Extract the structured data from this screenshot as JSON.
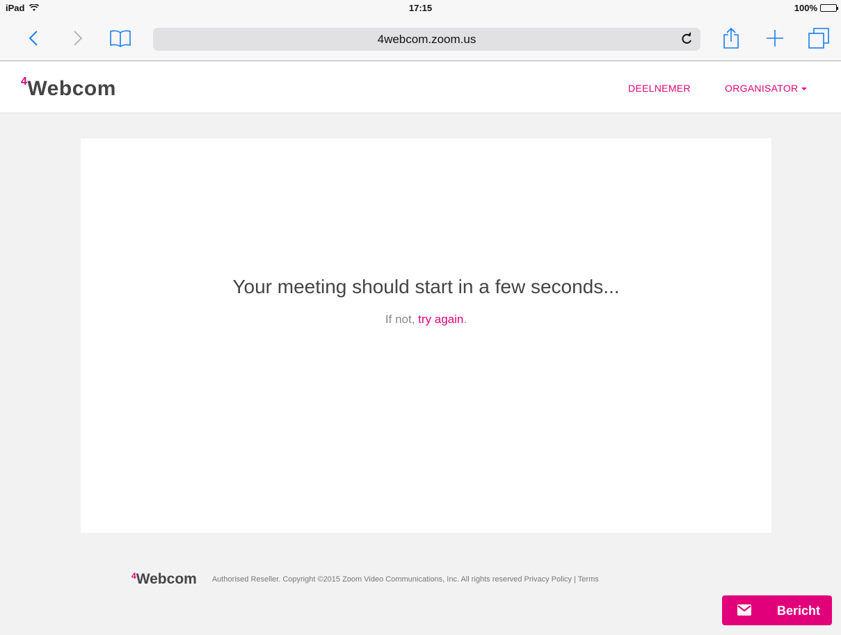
{
  "statusbar": {
    "device": "iPad",
    "time": "17:15",
    "battery_percent": "100%"
  },
  "browser": {
    "url": "4webcom.zoom.us",
    "icons": {
      "back": "chevron-left-icon",
      "forward": "chevron-right-icon",
      "bookmarks": "book-icon",
      "reload": "reload-icon",
      "share": "share-icon",
      "new_tab": "plus-icon",
      "tabs": "tabs-icon"
    },
    "accent_color": "#1a7cf6"
  },
  "site": {
    "logo_superscript": "4",
    "logo_text": "Webcom",
    "nav": {
      "participant": "DEELNEMER",
      "organizer": "ORGANISATOR"
    },
    "brand_color": "#e2007a"
  },
  "main": {
    "headline": "Your meeting should start in a few seconds...",
    "sub_prefix": "If not, ",
    "sub_link": "try again",
    "sub_suffix": "."
  },
  "footer": {
    "logo_superscript": "4",
    "logo_text": "Webcom",
    "text": "Authorised Reseller. Copyright ©2015 Zoom Video Communications, Inc. All rights reserved Privacy Policy | Terms"
  },
  "message_button": {
    "label": "Bericht",
    "icon": "envelope-icon"
  }
}
